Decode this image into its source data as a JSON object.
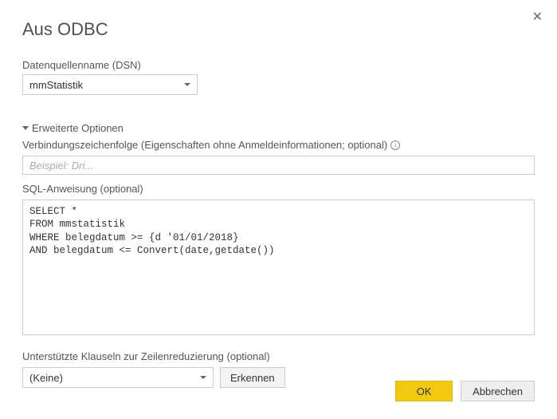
{
  "dialog": {
    "title": "Aus ODBC"
  },
  "dsn": {
    "label": "Datenquellenname (DSN)",
    "selected": "mmStatistik"
  },
  "advanced": {
    "toggle_label": "Erweiterte Optionen"
  },
  "connstr": {
    "label": "Verbindungszeichenfolge (Eigenschaften ohne Anmeldeinformationen; optional)",
    "placeholder": "Beispiel: Dri..."
  },
  "sql": {
    "label": "SQL-Anweisung (optional)",
    "value": "SELECT *\nFROM mmstatistik\nWHERE belegdatum >= {d '01/01/2018}\nAND belegdatum <= Convert(date,getdate())"
  },
  "reduce": {
    "label": "Unterstützte Klauseln zur Zeilenreduzierung (optional)",
    "selected": "(Keine)",
    "detect_btn": "Erkennen"
  },
  "actions": {
    "ok": "OK",
    "cancel": "Abbrechen"
  }
}
